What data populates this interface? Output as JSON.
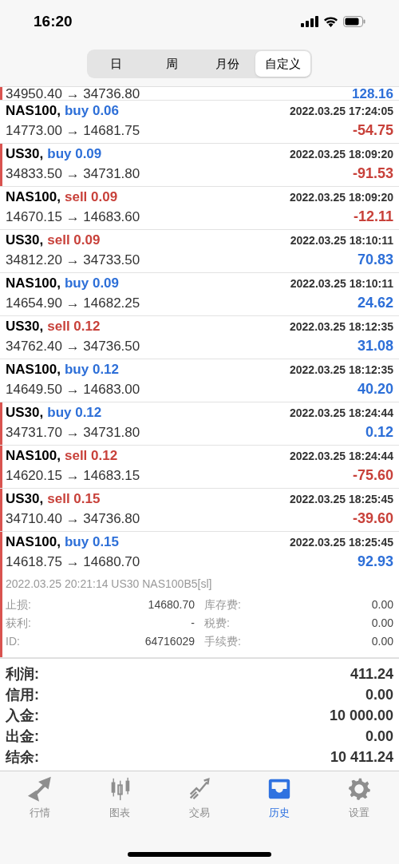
{
  "status_bar": {
    "time": "16:20"
  },
  "period_tabs": [
    {
      "label": "日",
      "selected": false
    },
    {
      "label": "周",
      "selected": false
    },
    {
      "label": "月份",
      "selected": false
    },
    {
      "label": "自定义",
      "selected": true
    }
  ],
  "partial_deal": {
    "prices": "34950.40 → 34736.80",
    "profit": "128.16",
    "loss": false,
    "marked": true
  },
  "deals": [
    {
      "symbol": "NAS100,",
      "sell": false,
      "volume": "buy 0.06",
      "time": "2022.03.25 17:24:05",
      "prices": "14773.00 → 14681.75",
      "profit": "-54.75",
      "loss": true,
      "marked": false
    },
    {
      "symbol": "US30,",
      "sell": false,
      "volume": "buy 0.09",
      "time": "2022.03.25 18:09:20",
      "prices": "34833.50 → 34731.80",
      "profit": "-91.53",
      "loss": true,
      "marked": true
    },
    {
      "symbol": "NAS100,",
      "sell": true,
      "volume": "sell 0.09",
      "time": "2022.03.25 18:09:20",
      "prices": "14670.15 → 14683.60",
      "profit": "-12.11",
      "loss": true,
      "marked": false
    },
    {
      "symbol": "US30,",
      "sell": true,
      "volume": "sell 0.09",
      "time": "2022.03.25 18:10:11",
      "prices": "34812.20 → 34733.50",
      "profit": "70.83",
      "loss": false,
      "marked": false
    },
    {
      "symbol": "NAS100,",
      "sell": false,
      "volume": "buy 0.09",
      "time": "2022.03.25 18:10:11",
      "prices": "14654.90 → 14682.25",
      "profit": "24.62",
      "loss": false,
      "marked": false
    },
    {
      "symbol": "US30,",
      "sell": true,
      "volume": "sell 0.12",
      "time": "2022.03.25 18:12:35",
      "prices": "34762.40 → 34736.50",
      "profit": "31.08",
      "loss": false,
      "marked": false
    },
    {
      "symbol": "NAS100,",
      "sell": false,
      "volume": "buy 0.12",
      "time": "2022.03.25 18:12:35",
      "prices": "14649.50 → 14683.00",
      "profit": "40.20",
      "loss": false,
      "marked": false
    },
    {
      "symbol": "US30,",
      "sell": false,
      "volume": "buy 0.12",
      "time": "2022.03.25 18:24:44",
      "prices": "34731.70 → 34731.80",
      "profit": "0.12",
      "loss": false,
      "marked": true
    },
    {
      "symbol": "NAS100,",
      "sell": true,
      "volume": "sell 0.12",
      "time": "2022.03.25 18:24:44",
      "prices": "14620.15 → 14683.15",
      "profit": "-75.60",
      "loss": true,
      "marked": true
    },
    {
      "symbol": "US30,",
      "sell": true,
      "volume": "sell 0.15",
      "time": "2022.03.25 18:25:45",
      "prices": "34710.40 → 34736.80",
      "profit": "-39.60",
      "loss": true,
      "marked": true
    },
    {
      "symbol": "NAS100,",
      "sell": false,
      "volume": "buy 0.15",
      "time": "2022.03.25 18:25:45",
      "prices": "14618.75 → 14680.70",
      "profit": "92.93",
      "loss": false,
      "marked": true,
      "expanded": true,
      "comment": "2022.03.25 20:21:14 US30 NAS100B5[sl]",
      "details": [
        {
          "label": "止损:",
          "value": "14680.70",
          "label2": "库存费:",
          "value2": "0.00"
        },
        {
          "label": "获利:",
          "value": "-",
          "label2": "税费:",
          "value2": "0.00"
        },
        {
          "label": "ID:",
          "value": "64716029",
          "label2": "手续费:",
          "value2": "0.00"
        }
      ]
    }
  ],
  "summary": [
    {
      "label": "利润:",
      "value": "411.24"
    },
    {
      "label": "信用:",
      "value": "0.00"
    },
    {
      "label": "入金:",
      "value": "10 000.00"
    },
    {
      "label": "出金:",
      "value": "0.00"
    },
    {
      "label": "结余:",
      "value": "10 411.24"
    }
  ],
  "tab_bar": [
    {
      "kind": "quotes",
      "label": "行情",
      "selected": false
    },
    {
      "kind": "chart",
      "label": "图表",
      "selected": false
    },
    {
      "kind": "trade",
      "label": "交易",
      "selected": false
    },
    {
      "kind": "history",
      "label": "历史",
      "selected": true
    },
    {
      "kind": "settings",
      "label": "设置",
      "selected": false
    }
  ]
}
